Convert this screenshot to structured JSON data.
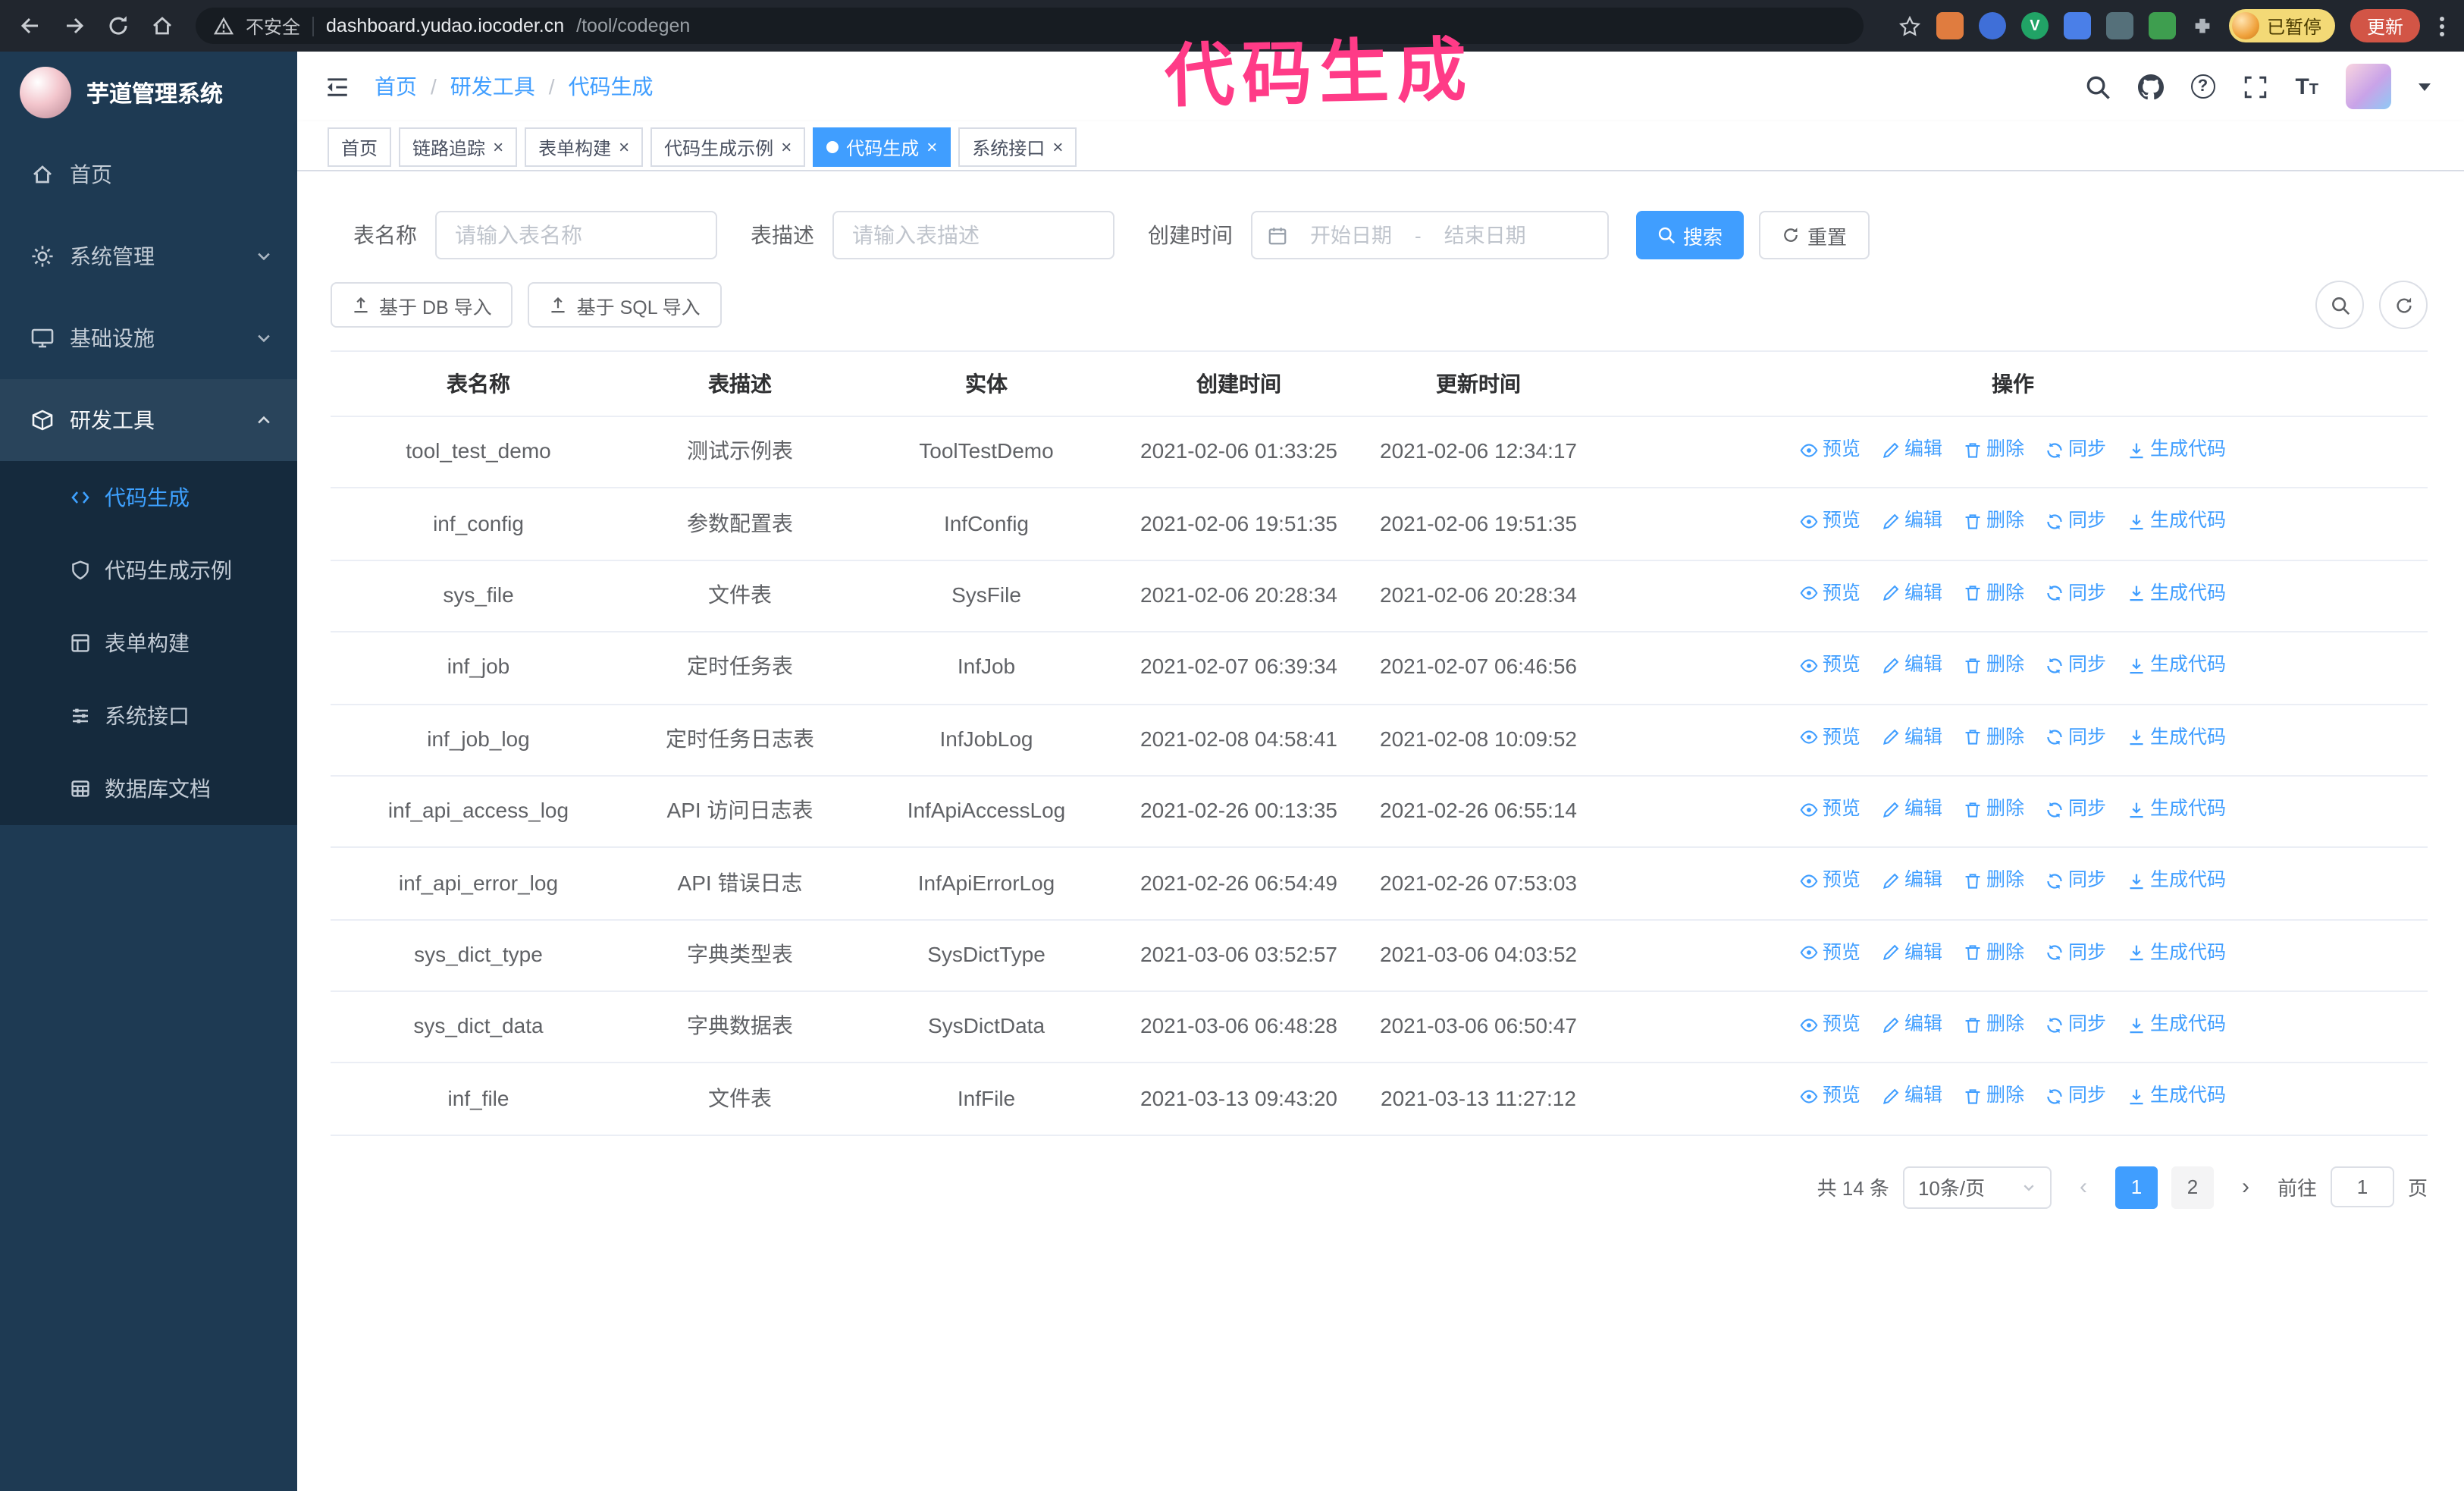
{
  "theme": {
    "accent": "#409eff",
    "annotation": "#ff3b87",
    "sidebar-bg": "#1e3a53",
    "submenu-bg": "#152a3d",
    "chrome-bg": "#21262e"
  },
  "annotation_text": "代码生成",
  "browser": {
    "security_label": "不安全",
    "url_host": "dashboard.yudao.iocoder.cn",
    "url_path": "/tool/codegen",
    "paused_badge": "已暂停",
    "update_button": "更新"
  },
  "sidebar": {
    "logo_title": "芋道管理系统",
    "items": [
      {
        "label": "首页",
        "icon": "home-icon"
      },
      {
        "label": "系统管理",
        "icon": "gear-icon"
      },
      {
        "label": "基础设施",
        "icon": "infrastructure-icon"
      },
      {
        "label": "研发工具",
        "icon": "devtools-icon"
      }
    ],
    "subitems": [
      {
        "label": "代码生成",
        "icon": "code-icon",
        "active": true
      },
      {
        "label": "代码生成示例",
        "icon": "example-icon"
      },
      {
        "label": "表单构建",
        "icon": "form-builder-icon"
      },
      {
        "label": "系统接口",
        "icon": "api-icon"
      },
      {
        "label": "数据库文档",
        "icon": "database-icon"
      }
    ]
  },
  "breadcrumb": {
    "items": [
      "首页",
      "研发工具",
      "代码生成"
    ]
  },
  "tabs": [
    {
      "label": "首页"
    },
    {
      "label": "链路追踪"
    },
    {
      "label": "表单构建"
    },
    {
      "label": "代码生成示例"
    },
    {
      "label": "代码生成",
      "active": true
    },
    {
      "label": "系统接口"
    }
  ],
  "filters": {
    "table_name_label": "表名称",
    "table_name_placeholder": "请输入表名称",
    "table_desc_label": "表描述",
    "table_desc_placeholder": "请输入表描述",
    "create_time_label": "创建时间",
    "date_start_placeholder": "开始日期",
    "date_separator": "-",
    "date_end_placeholder": "结束日期",
    "search_button": "搜索",
    "reset_button": "重置"
  },
  "toolbar": {
    "import_db_button": "基于 DB 导入",
    "import_sql_button": "基于 SQL 导入"
  },
  "table": {
    "columns": [
      "表名称",
      "表描述",
      "实体",
      "创建时间",
      "更新时间",
      "操作"
    ],
    "actions": [
      {
        "key": "eye",
        "label": "预览",
        "icon": "preview-eye-icon"
      },
      {
        "key": "pencil",
        "label": "编辑",
        "icon": "edit-pencil-icon"
      },
      {
        "key": "trash",
        "label": "删除",
        "icon": "delete-trash-icon"
      },
      {
        "key": "sync",
        "label": "同步",
        "icon": "sync-icon"
      },
      {
        "key": "download",
        "label": "生成代码",
        "icon": "generate-code-icon"
      }
    ],
    "rows": [
      {
        "name": "tool_test_demo",
        "desc": "测试示例表",
        "entity": "ToolTestDemo",
        "created": "2021-02-06 01:33:25",
        "updated": "2021-02-06 12:34:17"
      },
      {
        "name": "inf_config",
        "desc": "参数配置表",
        "entity": "InfConfig",
        "created": "2021-02-06 19:51:35",
        "updated": "2021-02-06 19:51:35"
      },
      {
        "name": "sys_file",
        "desc": "文件表",
        "entity": "SysFile",
        "created": "2021-02-06 20:28:34",
        "updated": "2021-02-06 20:28:34"
      },
      {
        "name": "inf_job",
        "desc": "定时任务表",
        "entity": "InfJob",
        "created": "2021-02-07 06:39:34",
        "updated": "2021-02-07 06:46:56"
      },
      {
        "name": "inf_job_log",
        "desc": "定时任务日志表",
        "entity": "InfJobLog",
        "created": "2021-02-08 04:58:41",
        "updated": "2021-02-08 10:09:52"
      },
      {
        "name": "inf_api_access_log",
        "desc": "API 访问日志表",
        "entity": "InfApiAccessLog",
        "created": "2021-02-26 00:13:35",
        "updated": "2021-02-26 06:55:14"
      },
      {
        "name": "inf_api_error_log",
        "desc": "API 错误日志",
        "entity": "InfApiErrorLog",
        "created": "2021-02-26 06:54:49",
        "updated": "2021-02-26 07:53:03"
      },
      {
        "name": "sys_dict_type",
        "desc": "字典类型表",
        "entity": "SysDictType",
        "created": "2021-03-06 03:52:57",
        "updated": "2021-03-06 04:03:52"
      },
      {
        "name": "sys_dict_data",
        "desc": "字典数据表",
        "entity": "SysDictData",
        "created": "2021-03-06 06:48:28",
        "updated": "2021-03-06 06:50:47"
      },
      {
        "name": "inf_file",
        "desc": "文件表",
        "entity": "InfFile",
        "created": "2021-03-13 09:43:20",
        "updated": "2021-03-13 11:27:12"
      }
    ]
  },
  "pagination": {
    "total": "共 14 条",
    "page_size": "10条/页",
    "pages": [
      "1",
      "2"
    ],
    "goto_label": "前往",
    "goto_value": "1",
    "goto_suffix": "页"
  }
}
